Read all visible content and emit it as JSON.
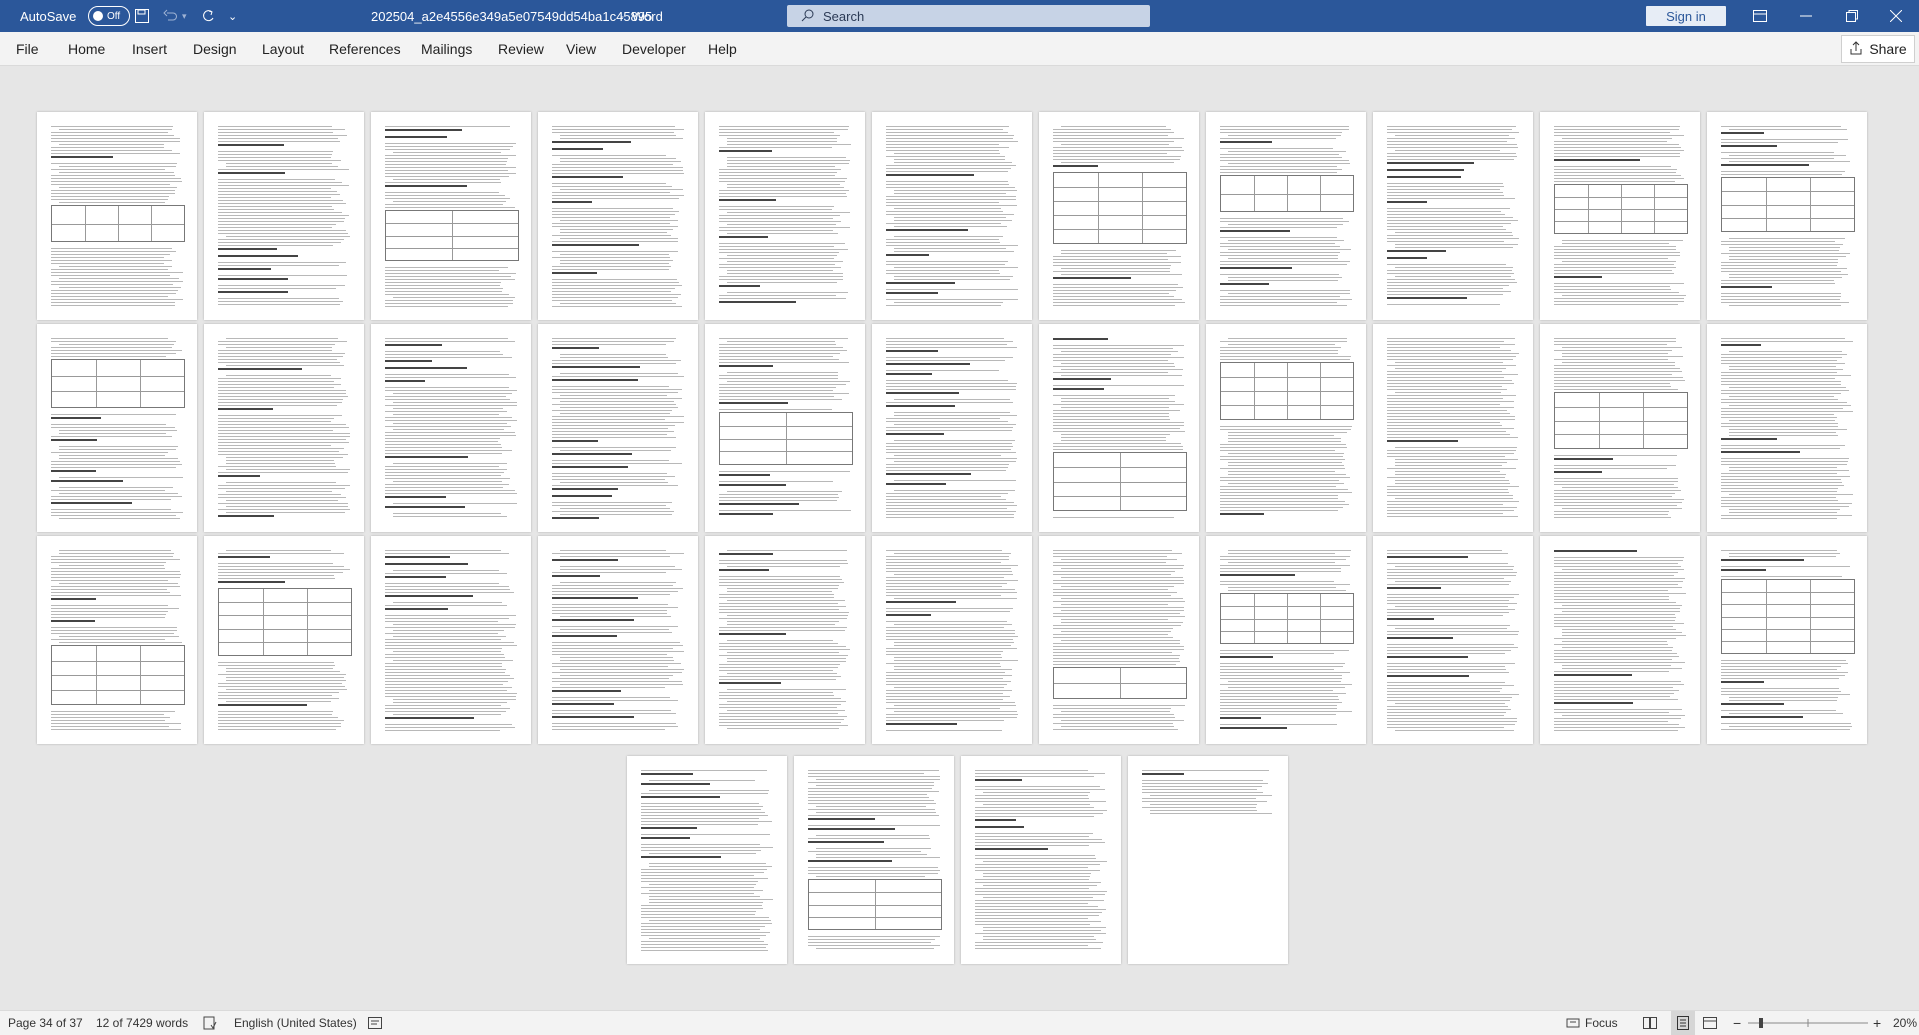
{
  "titlebar": {
    "autosave_label": "AutoSave",
    "autosave_state": "Off",
    "document_title": "202504_a2e4556e349a5e07549dd54ba1c45895",
    "app_name": "Word",
    "search_placeholder": "Search",
    "signin_label": "Sign in",
    "accent_color": "#2b579a"
  },
  "ribbon": {
    "tabs": [
      "File",
      "Home",
      "Insert",
      "Design",
      "Layout",
      "References",
      "Mailings",
      "Review",
      "View",
      "Developer",
      "Help"
    ],
    "share_label": "Share"
  },
  "statusbar": {
    "page_info": "Page 34 of 37",
    "word_count": "12 of 7429 words",
    "language": "English (United States)",
    "focus_label": "Focus",
    "zoom": "20%"
  },
  "document": {
    "page_count": 37,
    "view": "multi-page thumbnails"
  }
}
